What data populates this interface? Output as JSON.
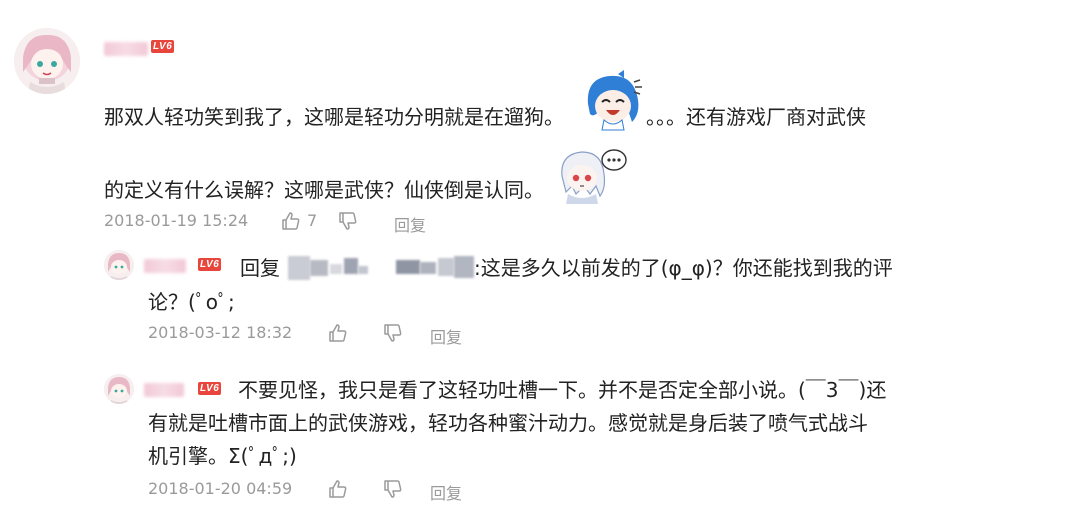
{
  "main_comment": {
    "level_badge": "LV6",
    "text_line1a": "那双人轻功笑到我了，这哪是轻功分明就是在遛狗。",
    "text_line1b": "。。。还有游戏厂商对武侠",
    "text_line2": "的定义有什么误解？这哪是武侠？仙侠倒是认同。",
    "timestamp": "2018-01-19 15:24",
    "like_count": "7",
    "reply_label": "回复"
  },
  "replies": [
    {
      "level_badge": "LV6",
      "reply_prefix": "回复",
      "text_line1": ":这是多久以前发的了(φ_φ)？你还能找到我的评",
      "text_line2": "论？(ﾟoﾟ;",
      "timestamp": "2018-03-12 18:32",
      "reply_label": "回复"
    },
    {
      "level_badge": "LV6",
      "text_line1": "不要见怪，我只是看了这轻功吐槽一下。并不是否定全部小说。(￣3￣)还",
      "text_line2": "有就是吐槽市面上的武侠游戏，轻功各种蜜汁动力。感觉就是身后装了喷气式战斗",
      "text_line3": "机引擎。Σ(ﾟдﾟ;)",
      "timestamp": "2018-01-20 04:59",
      "reply_label": "回复"
    }
  ],
  "icons": {
    "like": "thumbs-up-icon",
    "dislike": "thumbs-down-icon"
  },
  "colors": {
    "level_badge": "#e8453c",
    "meta_text": "#9a9a9a",
    "body_text": "#222222"
  }
}
